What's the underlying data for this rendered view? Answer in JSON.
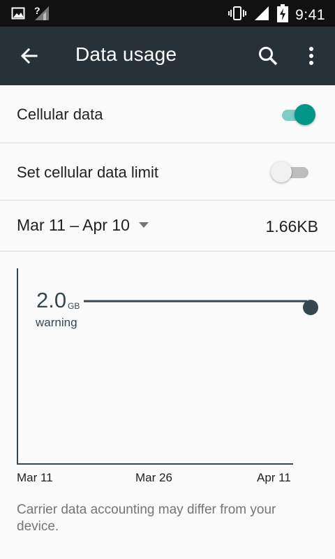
{
  "status_bar": {
    "time": "9:41",
    "icons": [
      "image-icon",
      "signal-unknown-icon",
      "vibrate-icon",
      "cell-signal-icon",
      "battery-charging-icon"
    ]
  },
  "app_bar": {
    "title": "Data usage",
    "icons": [
      "back-arrow-icon",
      "search-icon",
      "more-vert-icon"
    ]
  },
  "settings": {
    "cellular_data": {
      "label": "Cellular data",
      "enabled": true
    },
    "data_limit": {
      "label": "Set cellular data limit",
      "enabled": false
    }
  },
  "cycle": {
    "range": "Mar 11 – Apr 10",
    "total": "1.66KB"
  },
  "chart": {
    "warning_value": "2.0",
    "warning_unit": "GB",
    "warning_label": "warning",
    "x_labels": [
      "Mar 11",
      "Mar 26",
      "Apr 11"
    ]
  },
  "chart_data": {
    "type": "line",
    "x": [
      "Mar 11",
      "Mar 26",
      "Apr 11"
    ],
    "series": [],
    "annotations": [
      {
        "text": "warning",
        "value": "2.0 GB"
      }
    ],
    "xlabel": "",
    "ylabel": "",
    "grid": false
  },
  "footnote": "Carrier data accounting may differ from your device.",
  "colors": {
    "app_bar": "#263238",
    "status_bar": "#111111",
    "accent": "#009688",
    "chart_line": "#37474f"
  }
}
